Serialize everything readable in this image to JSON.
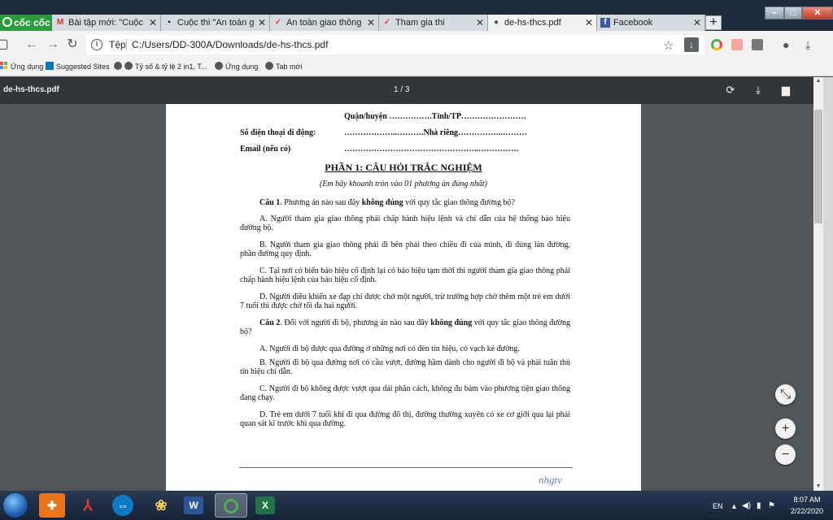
{
  "browser": {
    "brand_label": "cốc cốc",
    "tabs": [
      {
        "label": "Bài tập mới: \"Cuộc thi",
        "icon": "M",
        "active": false
      },
      {
        "label": "Cuộc thi \"An toàn gia",
        "icon": "▪",
        "active": false
      },
      {
        "label": "An toàn giao thông c",
        "icon": "✓",
        "active": false
      },
      {
        "label": "Tham gia thi",
        "icon": "✓",
        "active": false
      },
      {
        "label": "de-hs-thcs.pdf",
        "icon": "●",
        "active": true
      },
      {
        "label": "Facebook",
        "icon": "f",
        "active": false
      }
    ],
    "new_tab_label": "+",
    "window_buttons": {
      "minimize": "–",
      "maximize": "□",
      "close": "✕"
    },
    "address": {
      "scheme": "Tệp",
      "url": "C:/Users/DD-300A/Downloads/de-hs-thcs.pdf"
    },
    "bookmarks": [
      "Ứng dụng",
      "Suggested Sites",
      "Tỷ số & tỷ lệ 2 in1, T...",
      "Ứng dụng",
      "Tab mới"
    ]
  },
  "pdf": {
    "title": "de-hs-thcs.pdf",
    "page_indicator": "1 / 3",
    "lines": {
      "district": "Quận/huyện …………….Tỉnh/TP……………………",
      "phone_label": "Số điện thoại di động:",
      "phone_value": "………………..……….Nhà riêng……………..………",
      "email_label": "Email (nếu có)",
      "email_value": "…………………………………………..……………"
    },
    "section_title": "PHẦN 1: CÂU HỎI TRẮC NGHIỆM",
    "section_subtitle": "(Em hãy khoanh tròn vào 01 phương án đúng nhất)",
    "q1": {
      "num": "Câu 1",
      "pre": ". Phương án nào sau đây ",
      "bold": "không đúng",
      "post": " với quy tắc giao thông đường bộ?",
      "options": [
        "A. Người tham gia giao thông phải chấp hành hiệu lệnh và chỉ dẫn của hệ thống báo hiệu đường bộ.",
        "B. Người tham gia giao thông phải đi bên phải theo chiều đi của mình, đi đúng làn đường, phần đường quy định.",
        "C. Tại nơi có biển báo hiệu cố định lại có báo hiệu tạm thời thì người tham gia giao thông phải chấp hành hiệu lệnh của báo hiệu cố định.",
        "D. Người điều khiển xe đạp chỉ được chở một người, trừ trường hợp chở thêm một trẻ em dưới 7 tuổi thì được chở tối đa hai người."
      ]
    },
    "q2": {
      "num": "Câu 2",
      "pre": ". Đối với người đi bộ, phương án nào sau đây ",
      "bold": "không đúng",
      "post": " với quy tắc giao thông đường bộ?",
      "options": [
        "A. Người đi bộ được qua đường ở những nơi có đèn tín hiệu, có vạch kẻ đường.",
        "B. Người đi bộ qua đường nơi có cầu vượt, đường hầm dành cho người đi bộ và phải tuân thủ tín hiệu chỉ dẫn.",
        "C. Người đi bộ không được vượt qua dải phân cách, không đu bám vào phương tiện giao thông đang chạy.",
        "D. Trẻ em dưới 7 tuổi khi đi qua đường đô thị, đường thường xuyên có xe cơ giới qua lại phải quan sát kĩ trước khi qua đường."
      ]
    },
    "signature": "nhgtv"
  },
  "zoom_controls": {
    "fit": "⤡",
    "zoom_in": "+",
    "zoom_out": "−"
  },
  "taskbar": {
    "tray_lang": "EN",
    "time": "8:07 AM",
    "date": "2/22/2020"
  },
  "colors": {
    "pdf_toolbar": "#323639",
    "viewer_bg": "#525659",
    "brand": "#2d9a3c"
  }
}
